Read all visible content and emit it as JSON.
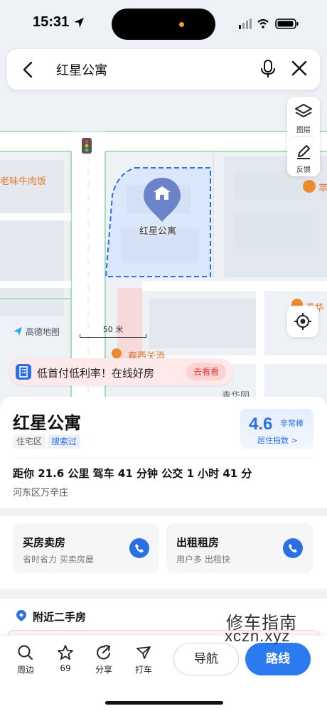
{
  "status_bar": {
    "time": "15:31"
  },
  "search": {
    "query": "红星公寓"
  },
  "map_tools": {
    "layers_label": "图层",
    "feedback_label": "反馈"
  },
  "map": {
    "poi_name": "红星公寓",
    "labels": [
      "老味牛肉饭",
      "萃",
      "青华",
      "春西关添",
      "青华园"
    ],
    "brand": "高德地图",
    "scale": "50 米"
  },
  "promo": {
    "text": "低首付低利率！在线好房",
    "button": "去看看"
  },
  "place": {
    "title": "红星公寓",
    "tags": [
      "住宅区",
      "搜索过"
    ],
    "rating": {
      "score": "4.6",
      "word": "非常棒",
      "label": "居住指数 >"
    },
    "distance_line": "距你 21.6 公里   驾车 41 分钟   公交 1 小时 41 分",
    "address": "河东区万辛庄"
  },
  "services": [
    {
      "title": "买房卖房",
      "subtitle": "省时省力 买卖房屋"
    },
    {
      "title": "出租租房",
      "subtitle": "用户多 出租快"
    }
  ],
  "nearby": {
    "title": "附近二手房"
  },
  "watermark": {
    "line1": "修车指南",
    "line2": "xczn.xyz"
  },
  "toolbar": {
    "items": [
      {
        "label": "周边"
      },
      {
        "label": "69"
      },
      {
        "label": "分享"
      },
      {
        "label": "打车"
      }
    ],
    "navigate": "导航",
    "route": "路线"
  },
  "colors": {
    "accent": "#2b7af0",
    "rating_blue": "#2b6fe6",
    "promo_bg": "#fde9ea"
  }
}
